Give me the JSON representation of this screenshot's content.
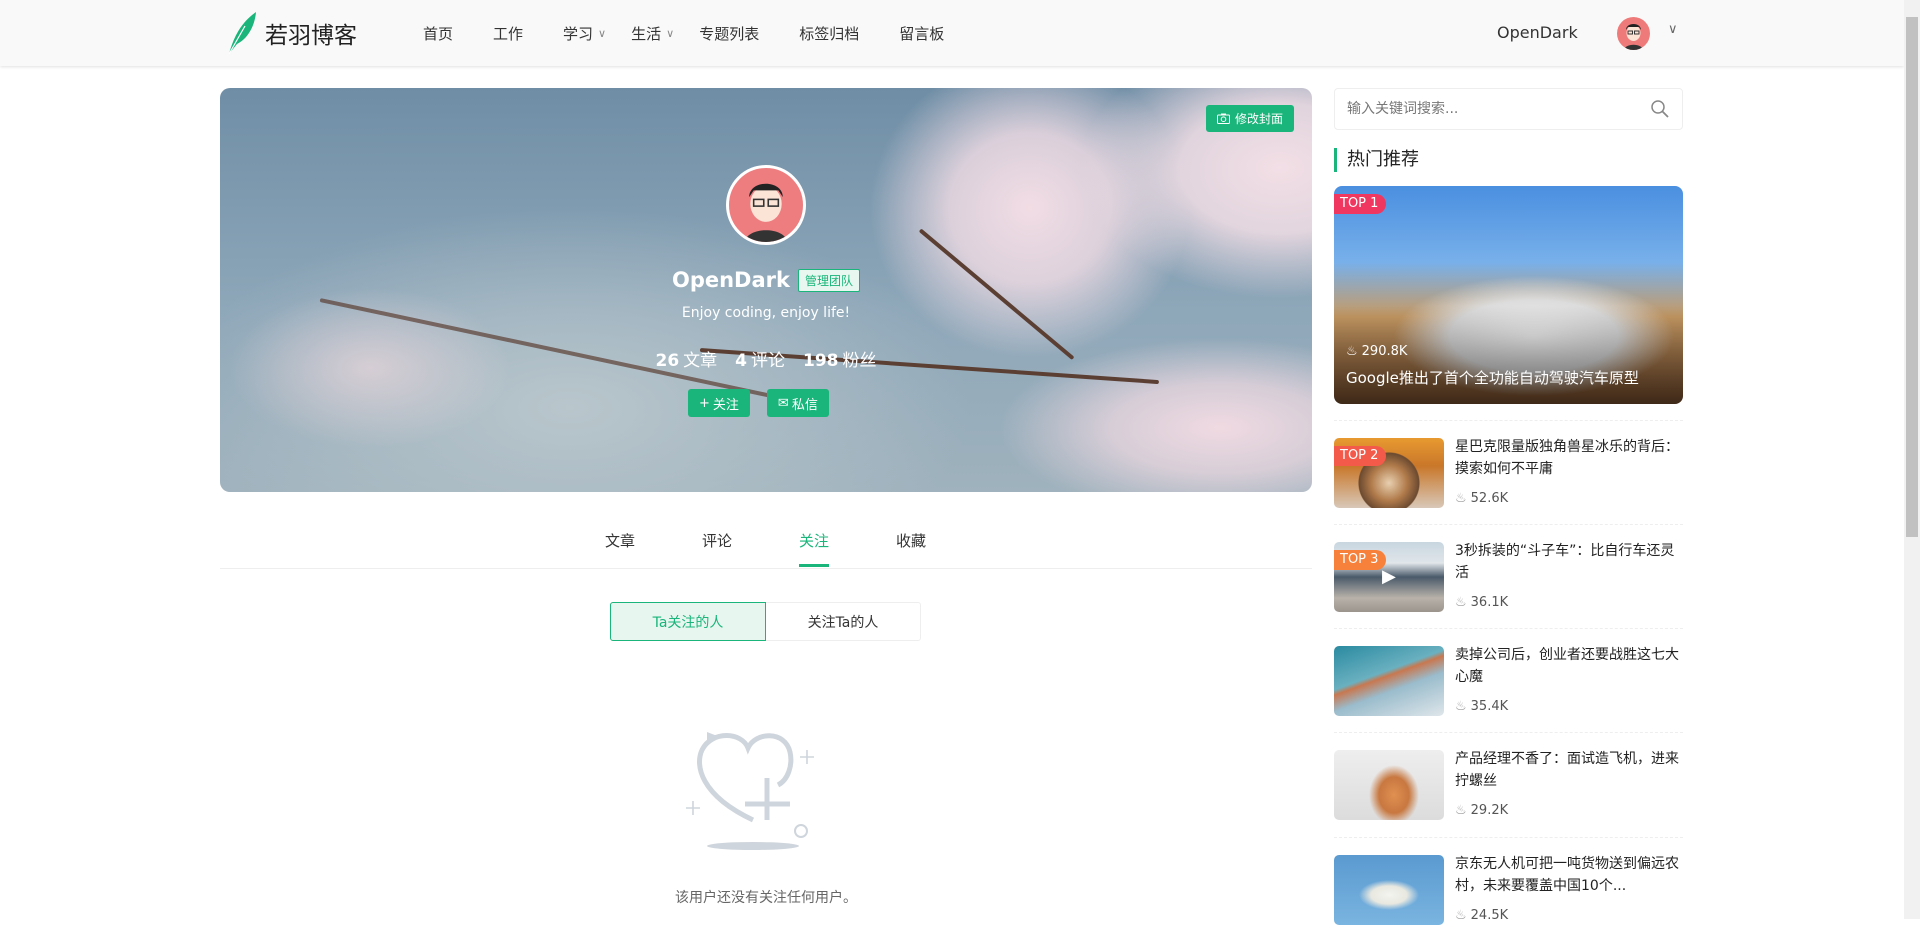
{
  "header": {
    "logo": "若羽博客",
    "nav": [
      {
        "label": "首页"
      },
      {
        "label": "工作"
      },
      {
        "label": "学习",
        "dropdown": true
      },
      {
        "label": "生活",
        "dropdown": true
      },
      {
        "label": "专题列表"
      },
      {
        "label": "标签归档"
      },
      {
        "label": "留言板"
      }
    ],
    "username": "OpenDark"
  },
  "profile": {
    "edit_cover": "修改封面",
    "name": "OpenDark",
    "badge": "管理团队",
    "bio": "Enjoy coding, enjoy life!",
    "stats": [
      {
        "value": "26",
        "label": "文章"
      },
      {
        "value": "4",
        "label": "评论"
      },
      {
        "value": "198",
        "label": "粉丝"
      }
    ],
    "follow": "关注",
    "message": "私信"
  },
  "tabs": [
    {
      "label": "文章"
    },
    {
      "label": "评论"
    },
    {
      "label": "关注",
      "active": true
    },
    {
      "label": "收藏"
    }
  ],
  "segments": [
    {
      "label": "Ta关注的人",
      "active": true
    },
    {
      "label": "关注Ta的人"
    }
  ],
  "empty_text": "该用户还没有关注任何用户。",
  "sidebar": {
    "search_placeholder": "输入关键词搜索...",
    "hot_title": "热门推荐",
    "top": {
      "rank": "TOP 1",
      "views": "290.8K",
      "title": "Google推出了首个全功能自动驾驶汽车原型"
    },
    "items": [
      {
        "rank": "TOP 2",
        "title": "星巴克限量版独角兽星冰乐的背后：摸索如何不平庸",
        "views": "52.6K"
      },
      {
        "rank": "TOP 3",
        "title": "3秒拆装的“斗子车”：比自行车还灵活",
        "views": "36.1K"
      },
      {
        "rank": "",
        "title": "卖掉公司后，创业者还要战胜这七大心魔",
        "views": "35.4K"
      },
      {
        "rank": "",
        "title": "产品经理不香了：面试造飞机，进来拧螺丝",
        "views": "29.2K"
      },
      {
        "rank": "",
        "title": "京东无人机可把一吨货物送到偏远农村，未来要覆盖中国10个...",
        "views": "24.5K"
      }
    ]
  },
  "colors": {
    "accent": "#19b57a",
    "top1": "#f0375f",
    "top2": "#f45a4a",
    "top3": "#f7813a"
  }
}
